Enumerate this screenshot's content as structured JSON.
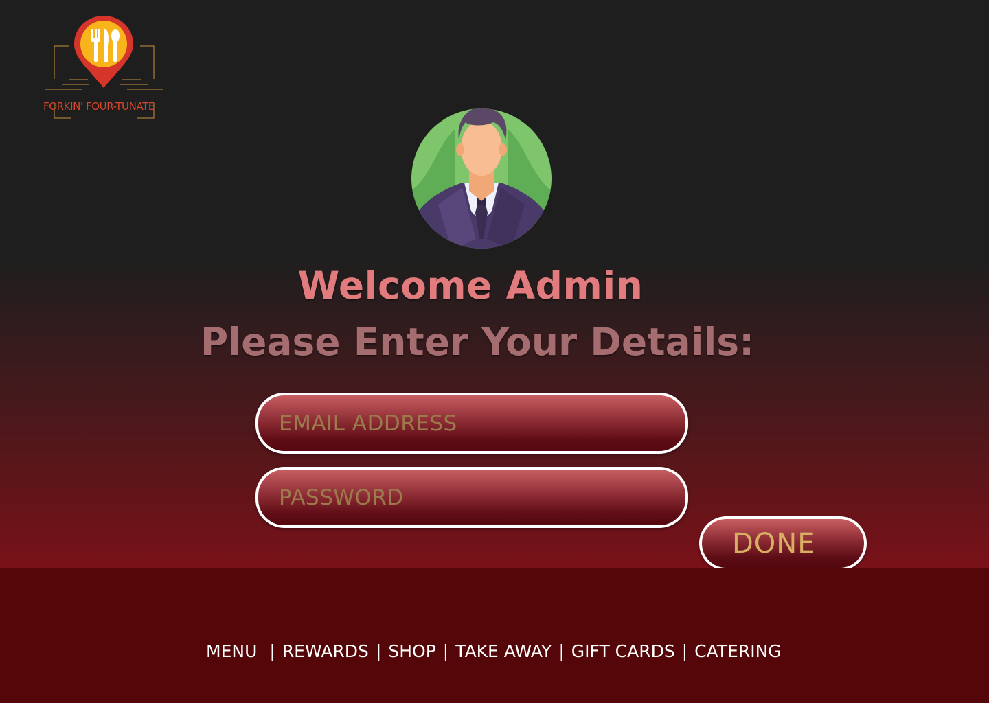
{
  "brand": {
    "name": "FORKIN' FOUR-TUNATE",
    "logo_icon": "fork-knife-spoon-pin-icon",
    "pin_color": "#d6352b",
    "pin_fill": "#f7b51b"
  },
  "avatar": {
    "icon": "admin-avatar-icon"
  },
  "heading": {
    "welcome": "Welcome Admin",
    "prompt": "Please Enter Your Details:"
  },
  "form": {
    "email_placeholder": "EMAIL ADDRESS",
    "password_placeholder": "PASSWORD",
    "submit_label": "DONE"
  },
  "nav": {
    "items": [
      {
        "label": "MENU"
      },
      {
        "label": "REWARDS"
      },
      {
        "label": "SHOP"
      },
      {
        "label": "TAKE AWAY"
      },
      {
        "label": "GIFT CARDS"
      },
      {
        "label": "CATERING"
      }
    ],
    "separator": "|"
  },
  "colors": {
    "accent_gold": "#d7ae62",
    "heading_pink": "#e27b7e",
    "footer_bg": "#550609",
    "page_top": "#1e1e1e"
  }
}
